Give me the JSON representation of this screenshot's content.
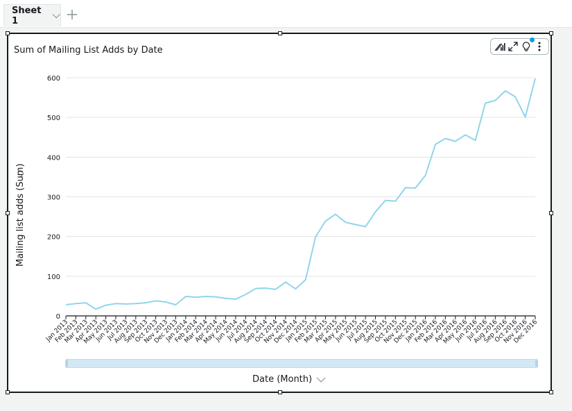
{
  "sheet_tabs": [
    {
      "label": "Sheet 1",
      "active": true
    }
  ],
  "add_tab_icon": "plus-icon",
  "visual": {
    "title": "Sum of Mailing List Adds by Date",
    "toolbar": [
      "bar-chart-format-icon",
      "expand-icon",
      "lightbulb-insight-icon",
      "more-options-icon"
    ],
    "x_field_label": "Date (Month)",
    "y_field_label": "Mailing list adds (Sum)"
  },
  "chart_data": {
    "type": "line",
    "title": "Sum of Mailing List Adds by Date",
    "xlabel": "Date (Month)",
    "ylabel": "Mailing list adds (Sum)",
    "ylim": [
      0,
      600
    ],
    "yticks": [
      0,
      100,
      200,
      300,
      400,
      500,
      600
    ],
    "grid": true,
    "line_color": "#90d5ec",
    "categories": [
      "Jan 2013",
      "Feb 2013",
      "Mar 2013",
      "Apr 2013",
      "May 2013",
      "Jun 2013",
      "Jul 2013",
      "Aug 2013",
      "Sep 2013",
      "Oct 2013",
      "Nov 2013",
      "Dec 2013",
      "Jan 2014",
      "Feb 2014",
      "Mar 2014",
      "Apr 2014",
      "May 2014",
      "Jun 2014",
      "Jul 2014",
      "Aug 2014",
      "Sep 2014",
      "Oct 2014",
      "Nov 2014",
      "Dec 2014",
      "Jan 2015",
      "Feb 2015",
      "Mar 2015",
      "Apr 2015",
      "May 2015",
      "Jun 2015",
      "Jul 2015",
      "Aug 2015",
      "Sep 2015",
      "Oct 2015",
      "Nov 2015",
      "Dec 2015",
      "Jan 2016",
      "Feb 2016",
      "Mar 2016",
      "Apr 2016",
      "May 2016",
      "Jun 2016",
      "Jul 2016",
      "Aug 2016",
      "Sep 2016",
      "Oct 2016",
      "Nov 2016",
      "Dec 2016"
    ],
    "series": [
      {
        "name": "Mailing list adds (Sum)",
        "values": [
          28,
          31,
          33,
          17,
          27,
          31,
          30,
          31,
          33,
          38,
          35,
          28,
          49,
          47,
          49,
          48,
          44,
          42,
          54,
          69,
          70,
          67,
          85,
          68,
          91,
          199,
          239,
          256,
          236,
          230,
          225,
          262,
          291,
          289,
          323,
          322,
          354,
          432,
          447,
          440,
          456,
          442,
          536,
          543,
          567,
          552,
          501,
          598
        ]
      }
    ]
  }
}
